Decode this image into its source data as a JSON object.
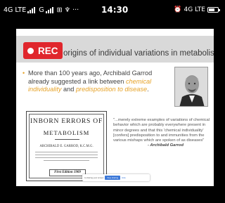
{
  "status_bar": {
    "sim1": "4G LTE",
    "sim2": "G",
    "extra_icons": "⊞ ♆ ···",
    "time": "14:30",
    "alarm_icon": "alarm-clock-icon",
    "network_right": "4G LTE"
  },
  "recording": {
    "label": "REC",
    "color": "#e0262c"
  },
  "slide": {
    "title": "origins of individual variations in metabolism",
    "bullet": {
      "part1": "More than 100 years ago, Archibald Garrod already suggested a link between ",
      "highlight1": "chemical individuality",
      "part2": " and ",
      "highlight2": "predisposition to disease",
      "part3": ".",
      "highlight_color": "#e6a227"
    },
    "book_cover": {
      "title_line1": "INBORN ERRORS OF",
      "title_line2": "METABOLISM",
      "author": "ARCHIBALD E. GARROD, K.C.M.G.",
      "edition": "First Edition 1909"
    },
    "quote": {
      "text": "\"...merely extreme examples of variations of chemical behavior which are probably everywhere present in minor degrees and that this 'chemical individuality' [confers] predisposition to and immunities from the various mishaps which are spoken of as diseases\"",
      "author": "- Archibald Garrod"
    }
  },
  "screen_share": {
    "message": "is sharing your screen",
    "stop_label": "Stop sharing",
    "hide_label": "Hide"
  }
}
